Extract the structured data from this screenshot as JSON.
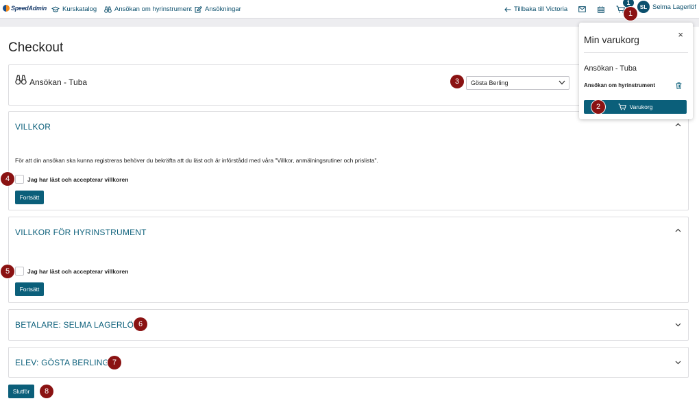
{
  "app": {
    "logo_text": "SpeedAdmin"
  },
  "nav": {
    "kurskatalog": "Kurskatalog",
    "ansokan_hyr": "Ansökan om hyrinstrument",
    "ansokningar": "Ansökningar",
    "back": "Tillbaka till Victoria"
  },
  "user": {
    "initials": "SL",
    "name": "Selma Lagerlöf",
    "cart_count": "1"
  },
  "page": {
    "title": "Checkout"
  },
  "product": {
    "name": "Ansökan - Tuba",
    "selected_student": "Gösta Berling"
  },
  "villkor": {
    "title": "VILLKOR",
    "text": "För att din ansökan ska kunna registreras behöver du bekräfta att du läst och är införstådd med våra \"Villkor, anmälningsrutiner och prislista\".",
    "checkbox_label": "Jag har läst och accepterar villkoren",
    "continue_label": "Fortsätt"
  },
  "villkor_hyr": {
    "title": "VILLKOR FÖR HYRINSTRUMENT",
    "checkbox_label": "Jag har läst och accepterar villkoren",
    "continue_label": "Fortsätt"
  },
  "betalare": {
    "title": "BETALARE: SELMA LAGERLÖF"
  },
  "elev": {
    "title": "ELEV: GÖSTA BERLING"
  },
  "finish_label": "Slutför",
  "cart_popup": {
    "title": "Min varukorg",
    "close": "×",
    "item_name": "Ansökan - Tuba",
    "item_sub": "Ansökan om hyrinstrument",
    "button_label": "Varukorg"
  },
  "badges": [
    "1",
    "2",
    "3",
    "4",
    "5",
    "6",
    "7",
    "8"
  ],
  "colors": {
    "primary": "#0b5f7a",
    "badge": "#8a1212"
  }
}
